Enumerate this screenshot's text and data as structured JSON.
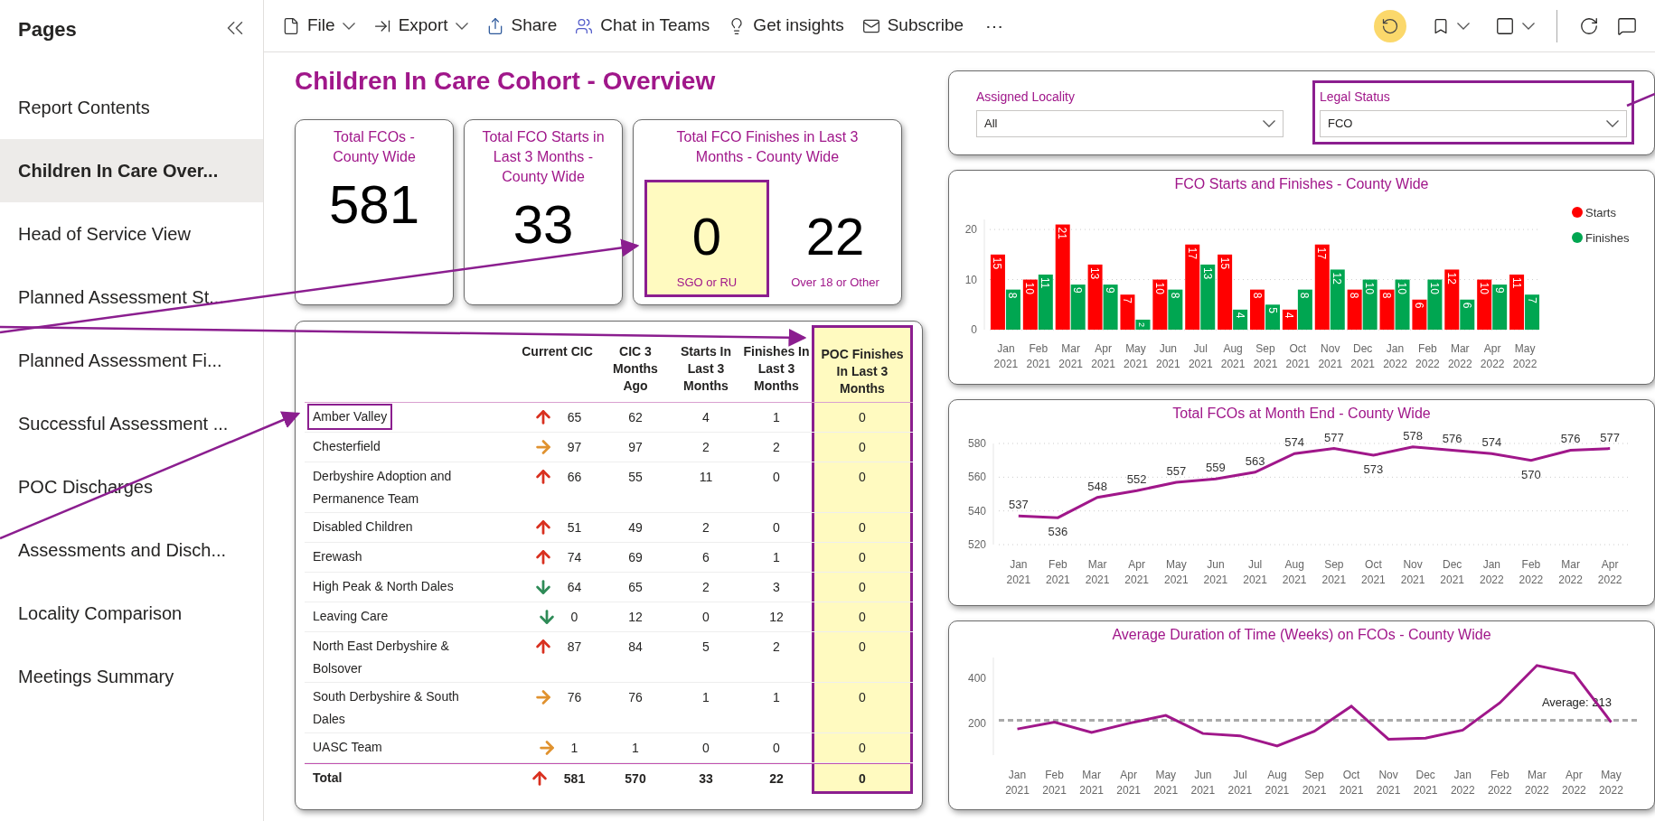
{
  "sidebar": {
    "title": "Pages",
    "items": [
      {
        "label": "Report Contents",
        "selected": false
      },
      {
        "label": "Children In Care Over...",
        "selected": true
      },
      {
        "label": "Head of Service View",
        "selected": false
      },
      {
        "label": "Planned Assessment St...",
        "selected": false
      },
      {
        "label": "Planned Assessment Fi...",
        "selected": false
      },
      {
        "label": "Successful Assessment ...",
        "selected": false
      },
      {
        "label": "POC Discharges",
        "selected": false
      },
      {
        "label": "Assessments and Disch...",
        "selected": false
      },
      {
        "label": "Locality Comparison",
        "selected": false
      },
      {
        "label": "Meetings Summary",
        "selected": false
      }
    ]
  },
  "toolbar": {
    "items": [
      {
        "kind": "file",
        "label": "File"
      },
      {
        "kind": "export",
        "label": "Export"
      },
      {
        "kind": "share",
        "label": "Share"
      },
      {
        "kind": "teams",
        "label": "Chat in Teams"
      },
      {
        "kind": "insights",
        "label": "Get insights"
      },
      {
        "kind": "subscribe",
        "label": "Subscribe"
      },
      {
        "kind": "more",
        "label": "⋯"
      }
    ]
  },
  "title": "Children In Care Cohort - Overview",
  "kpis": [
    {
      "title": "Total FCOs - County Wide",
      "value": "581"
    },
    {
      "title": "Total FCO Starts in Last 3 Months - County Wide",
      "value": "33"
    }
  ],
  "finishes_card": {
    "title": "Total FCO Finishes in Last 3 Months - County Wide",
    "tiles": [
      {
        "value": "0",
        "label": "SGO or RU",
        "highlighted": true
      },
      {
        "value": "22",
        "label": "Over 18 or Other",
        "highlighted": false
      }
    ]
  },
  "slicers": [
    {
      "label": "Assigned Locality",
      "value": "All",
      "highlighted": false
    },
    {
      "label": "Legal Status",
      "value": "FCO",
      "highlighted": true
    }
  ],
  "table": {
    "columns": [
      {
        "label": "Current CIC",
        "highlighted": false
      },
      {
        "label": "CIC 3 Months Ago",
        "highlighted": false
      },
      {
        "label": "Starts In Last 3 Months",
        "highlighted": false
      },
      {
        "label": "Finishes In Last 3 Months",
        "highlighted": false
      },
      {
        "label": "POC Finishes In Last 3 Months",
        "highlighted": true
      }
    ],
    "rows": [
      {
        "kind": "up",
        "name": "Amber Valley",
        "highlighted": true,
        "values": [
          "65",
          "62",
          "4",
          "1",
          "0"
        ]
      },
      {
        "kind": "right",
        "name": "Chesterfield",
        "highlighted": false,
        "values": [
          "97",
          "97",
          "2",
          "2",
          "0"
        ]
      },
      {
        "kind": "up",
        "name": "Derbyshire Adoption and Permanence Team",
        "highlighted": false,
        "values": [
          "66",
          "55",
          "11",
          "0",
          "0"
        ]
      },
      {
        "kind": "up",
        "name": "Disabled Children",
        "highlighted": false,
        "values": [
          "51",
          "49",
          "2",
          "0",
          "0"
        ]
      },
      {
        "kind": "up",
        "name": "Erewash",
        "highlighted": false,
        "values": [
          "74",
          "69",
          "6",
          "1",
          "0"
        ]
      },
      {
        "kind": "down",
        "name": "High Peak & North Dales",
        "highlighted": false,
        "values": [
          "64",
          "65",
          "2",
          "3",
          "0"
        ]
      },
      {
        "kind": "down",
        "name": "Leaving Care",
        "highlighted": false,
        "values": [
          "0",
          "12",
          "0",
          "12",
          "0"
        ]
      },
      {
        "kind": "up",
        "name": "North East Derbyshire & Bolsover",
        "highlighted": false,
        "values": [
          "87",
          "84",
          "5",
          "2",
          "0"
        ]
      },
      {
        "kind": "right",
        "name": "South Derbyshire & South Dales",
        "highlighted": false,
        "values": [
          "76",
          "76",
          "1",
          "1",
          "0"
        ]
      },
      {
        "kind": "right",
        "name": "UASC Team",
        "highlighted": false,
        "values": [
          "1",
          "1",
          "0",
          "0",
          "0"
        ]
      }
    ],
    "total": {
      "kind": "up",
      "name": "Total",
      "values": [
        "581",
        "570",
        "33",
        "22",
        "0"
      ]
    }
  },
  "charts": [
    {
      "chart_data": {
        "type": "bar",
        "title": "FCO Starts and Finishes - County Wide",
        "categories": [
          "Jan 2021",
          "Feb 2021",
          "Mar 2021",
          "Apr 2021",
          "May 2021",
          "Jun 2021",
          "Jul 2021",
          "Aug 2021",
          "Sep 2021",
          "Oct 2021",
          "Nov 2021",
          "Dec 2021",
          "Jan 2022",
          "Feb 2022",
          "Mar 2022",
          "Apr 2022",
          "May 2022"
        ],
        "series": [
          {
            "name": "Starts",
            "color": "#ff0000",
            "values": [
              15,
              10,
              21,
              13,
              7,
              10,
              17,
              15,
              8,
              4,
              17,
              8,
              8,
              6,
              12,
              10,
              11
            ]
          },
          {
            "name": "Finishes",
            "color": "#00a651",
            "values": [
              8,
              11,
              9,
              9,
              2,
              8,
              13,
              4,
              5,
              8,
              12,
              10,
              10,
              10,
              6,
              9,
              7
            ]
          }
        ],
        "ylim": [
          0,
          22
        ],
        "yticks": [
          0,
          10,
          20
        ],
        "grid": true,
        "legend": "right",
        "data_labels": true
      }
    },
    {
      "chart_data": {
        "type": "line",
        "title": "Total FCOs at Month End - County Wide",
        "categories": [
          "Jan 2021",
          "Feb 2021",
          "Mar 2021",
          "Apr 2021",
          "May 2021",
          "Jun 2021",
          "Jul 2021",
          "Aug 2021",
          "Sep 2021",
          "Oct 2021",
          "Nov 2021",
          "Dec 2021",
          "Jan 2022",
          "Feb 2022",
          "Mar 2022",
          "Apr 2022"
        ],
        "series": [
          {
            "color": "#a0178a",
            "values": [
              537,
              536,
              548,
              552,
              557,
              559,
              563,
              574,
              577,
              573,
              578,
              576,
              574,
              570,
              576,
              577
            ]
          }
        ],
        "ylim": [
          520,
          580
        ],
        "yticks": [
          520,
          540,
          560,
          580
        ],
        "grid": true,
        "data_labels": true
      }
    },
    {
      "chart_data": {
        "type": "line",
        "title": "Average Duration of Time (Weeks) on FCOs - County Wide",
        "categories": [
          "Jan 2021",
          "Feb 2021",
          "Mar 2021",
          "Apr 2021",
          "May 2021",
          "Jun 2021",
          "Jul 2021",
          "Aug 2021",
          "Sep 2021",
          "Oct 2021",
          "Nov 2021",
          "Dec 2021",
          "Jan 2022",
          "Feb 2022",
          "Mar 2022",
          "Apr 2022",
          "May 2022"
        ],
        "series": [
          {
            "color": "#a0178a",
            "values": [
              175,
              205,
              160,
              200,
              235,
              155,
              145,
              100,
              165,
              275,
              130,
              135,
              170,
              290,
              455,
              420,
              205
            ]
          }
        ],
        "ylim": [
          60,
          490
        ],
        "yticks": [
          200,
          400
        ],
        "ref_lines": [
          {
            "axis": "y",
            "value": 213,
            "label": "Average: 213",
            "color": "#aaaaaa"
          }
        ]
      }
    }
  ]
}
